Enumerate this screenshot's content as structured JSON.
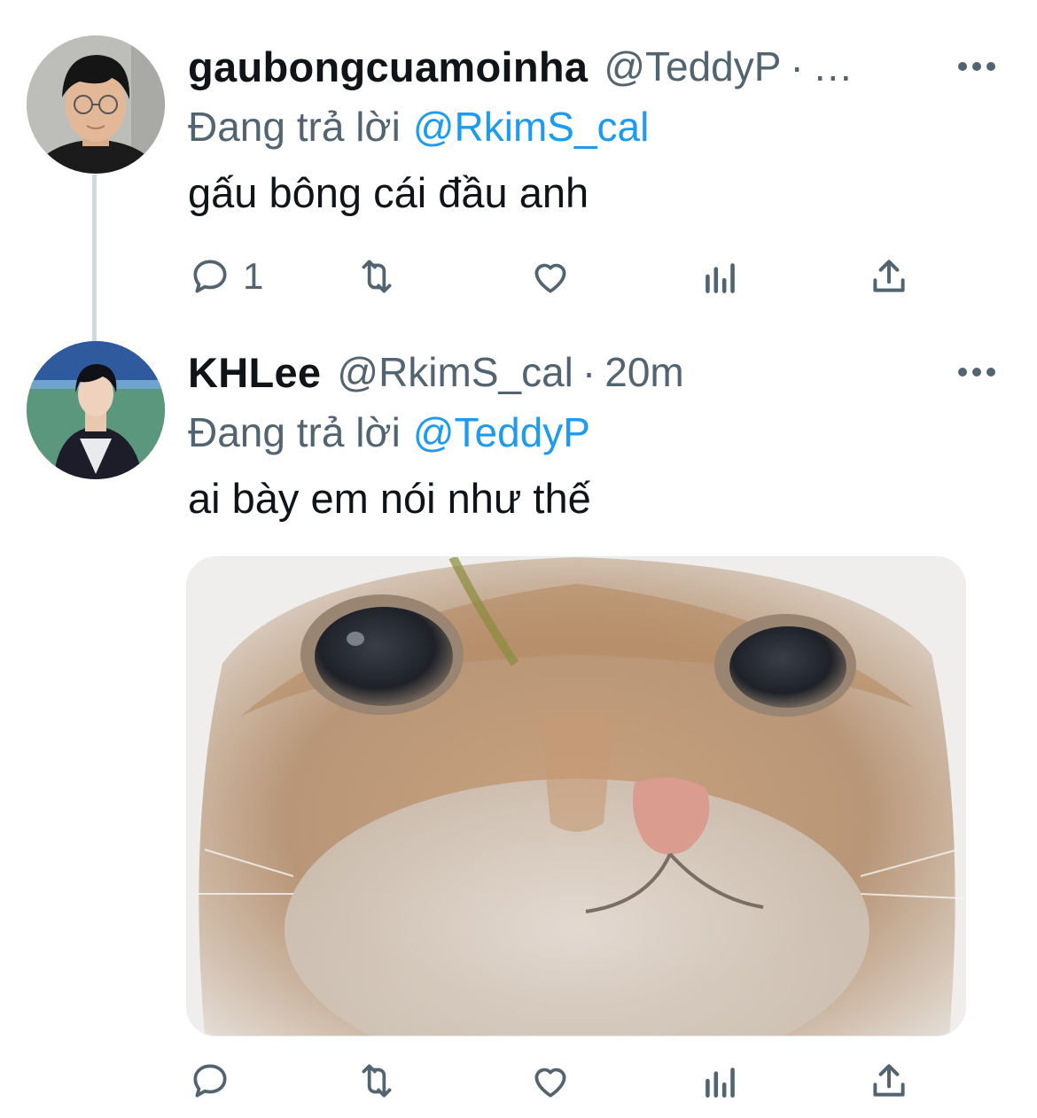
{
  "colors": {
    "link": "#1d9bf0",
    "secondary": "#536471",
    "primary_text": "#0f1419",
    "thread_line": "#cfd9de"
  },
  "tweets": [
    {
      "display_name": "gaubongcuamoinha",
      "handle": "@TeddyP",
      "separator": "·",
      "timestamp": "…",
      "reply_prefix": "Đang trả lời",
      "reply_to": "@RkimS_cal",
      "text": "gấu bông cái đầu anh",
      "actions": {
        "reply_count": "1",
        "retweet_count": "",
        "like_count": ""
      },
      "icons": [
        "more-icon",
        "reply-icon",
        "retweet-icon",
        "like-icon",
        "analytics-icon",
        "share-icon"
      ]
    },
    {
      "display_name": "KHLee",
      "handle": "@RkimS_cal",
      "separator": "·",
      "timestamp": "20m",
      "reply_prefix": "Đang trả lời",
      "reply_to": "@TeddyP",
      "text": "ai bày em nói như thế",
      "media": "cat-face-photo",
      "actions": {
        "reply_count": "",
        "retweet_count": "",
        "like_count": ""
      },
      "icons": [
        "more-icon",
        "reply-icon",
        "retweet-icon",
        "like-icon",
        "analytics-icon",
        "share-icon"
      ]
    }
  ]
}
